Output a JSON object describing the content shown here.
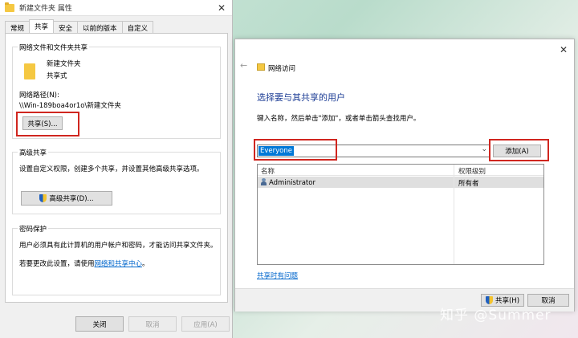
{
  "properties_dialog": {
    "title": "新建文件夹 属性",
    "tabs": [
      "常规",
      "共享",
      "安全",
      "以前的版本",
      "自定义"
    ],
    "active_tab": "共享",
    "network_sharing": {
      "group_title": "网络文件和文件夹共享",
      "folder_name": "新建文件夹",
      "share_status": "共享式",
      "path_label": "网络路径(N):",
      "path_value": "\\\\Win-189boa4or1o\\新建文件夹",
      "share_button": "共享(S)..."
    },
    "advanced_sharing": {
      "group_title": "高级共享",
      "description": "设置自定义权限，创建多个共享，并设置其他高级共享选项。",
      "button": "高级共享(D)..."
    },
    "password_protection": {
      "group_title": "密码保护",
      "description": "用户必须具有此计算机的用户帐户和密码，才能访问共享文件夹。",
      "change_prefix": "若要更改此设置，请使用",
      "change_link": "网络和共享中心",
      "change_suffix": "。"
    },
    "footer": {
      "close": "关闭",
      "cancel": "取消",
      "apply": "应用(A)"
    }
  },
  "network_access_dialog": {
    "title": "网络访问",
    "heading": "选择要与其共享的用户",
    "instruction": "键入名称，然后单击\"添加\"，或者单击箭头查找用户。",
    "input_value": "Everyone",
    "add_button": "添加(A)",
    "columns": [
      "名称",
      "权限级别"
    ],
    "rows": [
      {
        "name": "Administrator",
        "permission": "所有者"
      }
    ],
    "help_link": "共享时有问题",
    "share_button": "共享(H)",
    "cancel_button": "取消"
  },
  "watermark": "知乎 @Summer",
  "colors": {
    "highlight_border": "#d0261f",
    "selection_blue": "#0078d7",
    "heading_blue": "#1e3e96",
    "link_blue": "#0066cc"
  }
}
